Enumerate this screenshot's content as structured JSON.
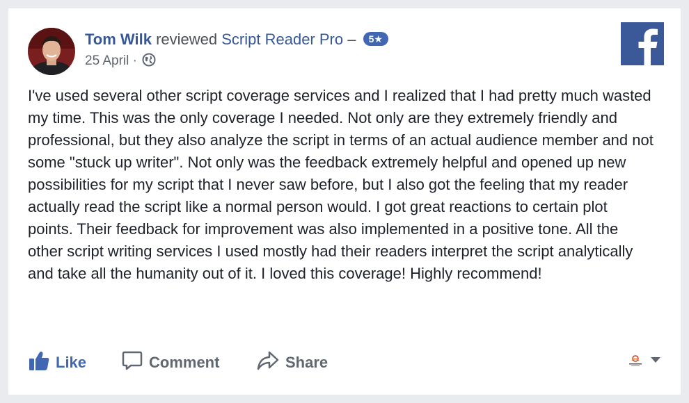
{
  "post": {
    "author_name": "Tom Wilk",
    "action_text": "reviewed",
    "page_name": "Script Reader Pro",
    "dash": "–",
    "rating_badge": "5★",
    "date": "25 April",
    "separator": "·",
    "privacy_icon": "globe-icon",
    "review": "I've used several other script coverage services and I realized that I had pretty much wasted my time. This was the only coverage I needed. Not only are they extremely friendly and professional, but they also analyze the script in terms of an actual audience member and not some \"stuck up writer\". Not only was the feedback extremely helpful and opened up new possibilities for my script that I never saw before, but I also got the feeling that my reader actually read the script like a normal person would. I got great reactions to certain plot points. Their feedback for improvement was also implemented in a positive tone. All the other script writing services I used mostly had their readers interpret the script analytically and take all the humanity out of it. I loved this coverage! Highly recommend!"
  },
  "actions": {
    "like_label": "Like",
    "comment_label": "Comment",
    "share_label": "Share"
  },
  "colors": {
    "facebook_blue": "#3b5998",
    "link_blue": "#365899",
    "like_blue": "#4267b2",
    "text": "#1d2129",
    "muted": "#606770"
  },
  "icons": {
    "brand": "facebook-logo-icon",
    "like": "thumbs-up-icon",
    "comment": "comment-bubble-icon",
    "share": "share-arrow-icon",
    "menu": "caret-down-icon"
  }
}
